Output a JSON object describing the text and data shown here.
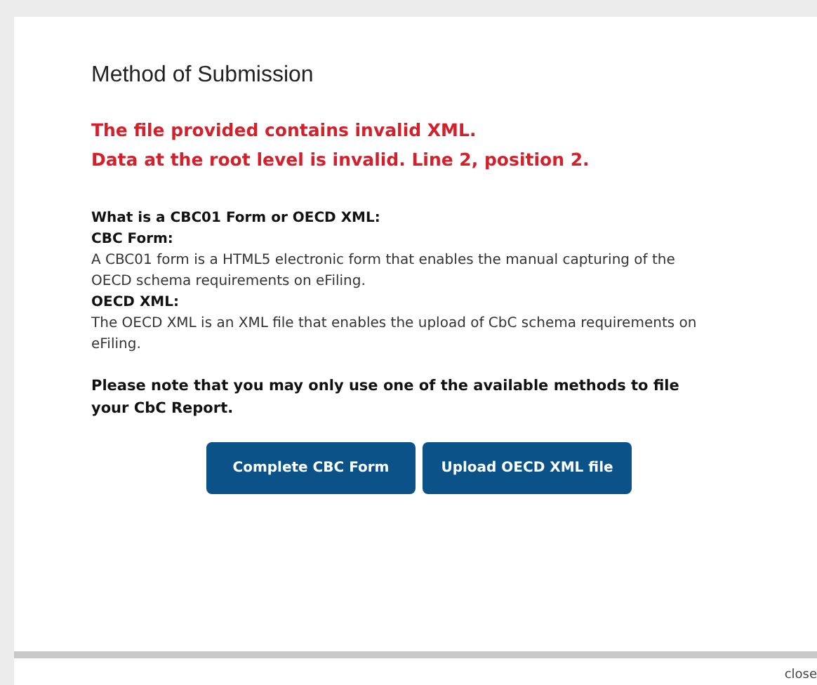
{
  "title": "Method of Submission",
  "errors": [
    "The file provided contains invalid XML.",
    "Data at the root level is invalid. Line 2, position 2."
  ],
  "info": [
    {
      "kind": "heading",
      "text": "What is a CBC01 Form or OECD XML:"
    },
    {
      "kind": "heading",
      "text": "CBC Form:"
    },
    {
      "kind": "body",
      "text": "A CBC01 form is a HTML5 electronic form that enables the manual capturing of the OECD schema requirements on eFiling."
    },
    {
      "kind": "heading",
      "text": "OECD XML:"
    },
    {
      "kind": "body",
      "text": "The OECD XML is an XML file that enables the upload of CbC schema requirements on eFiling."
    }
  ],
  "note": "Please note that you may only use one of the available methods to file your CbC Report.",
  "buttons": [
    "Complete CBC Form",
    "Upload OECD XML file"
  ],
  "close_link": "close"
}
